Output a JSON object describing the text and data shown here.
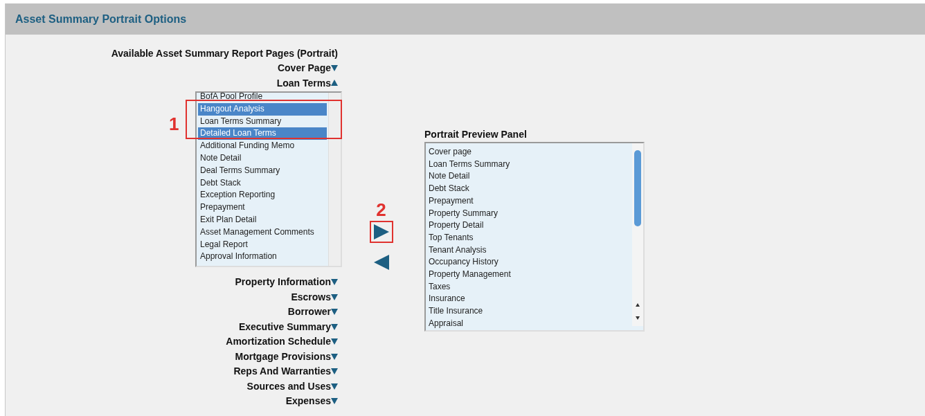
{
  "header": {
    "title": "Asset Summary Portrait Options"
  },
  "available": {
    "title": "Available Asset Summary Report Pages (Portrait)",
    "sections": [
      {
        "label": "Cover Page",
        "expanded": false
      },
      {
        "label": "Loan Terms",
        "expanded": true,
        "items": [
          {
            "label": "BofA Pool Profile",
            "selected": false
          },
          {
            "label": "Hangout Analysis",
            "selected": true
          },
          {
            "label": "Loan Terms Summary",
            "selected": false
          },
          {
            "label": "Detailed Loan Terms",
            "selected": true
          },
          {
            "label": "Additional Funding Memo",
            "selected": false
          },
          {
            "label": "Note Detail",
            "selected": false
          },
          {
            "label": "Deal Terms Summary",
            "selected": false
          },
          {
            "label": "Debt Stack",
            "selected": false
          },
          {
            "label": "Exception Reporting",
            "selected": false
          },
          {
            "label": "Prepayment",
            "selected": false
          },
          {
            "label": "Exit Plan Detail",
            "selected": false
          },
          {
            "label": "Asset Management Comments",
            "selected": false
          },
          {
            "label": "Legal Report",
            "selected": false
          },
          {
            "label": "Approval Information",
            "selected": false
          }
        ]
      },
      {
        "label": "Property Information",
        "expanded": false
      },
      {
        "label": "Escrows",
        "expanded": false
      },
      {
        "label": "Borrower",
        "expanded": false
      },
      {
        "label": "Executive Summary",
        "expanded": false
      },
      {
        "label": "Amortization Schedule",
        "expanded": false
      },
      {
        "label": "Mortgage Provisions",
        "expanded": false
      },
      {
        "label": "Reps And Warranties",
        "expanded": false
      },
      {
        "label": "Sources and Uses",
        "expanded": false
      },
      {
        "label": "Expenses",
        "expanded": false
      }
    ]
  },
  "annotations": [
    {
      "label": "1"
    },
    {
      "label": "2"
    }
  ],
  "preview": {
    "title": "Portrait Preview Panel",
    "items": [
      "Cover page",
      "Loan Terms Summary",
      "Note Detail",
      "Debt Stack",
      "Prepayment",
      "Property Summary",
      "Property Detail",
      "Top Tenants",
      "Tenant Analysis",
      "Occupancy History",
      "Property Management",
      "Taxes",
      "Insurance",
      "Title Insurance",
      "Appraisal"
    ]
  }
}
